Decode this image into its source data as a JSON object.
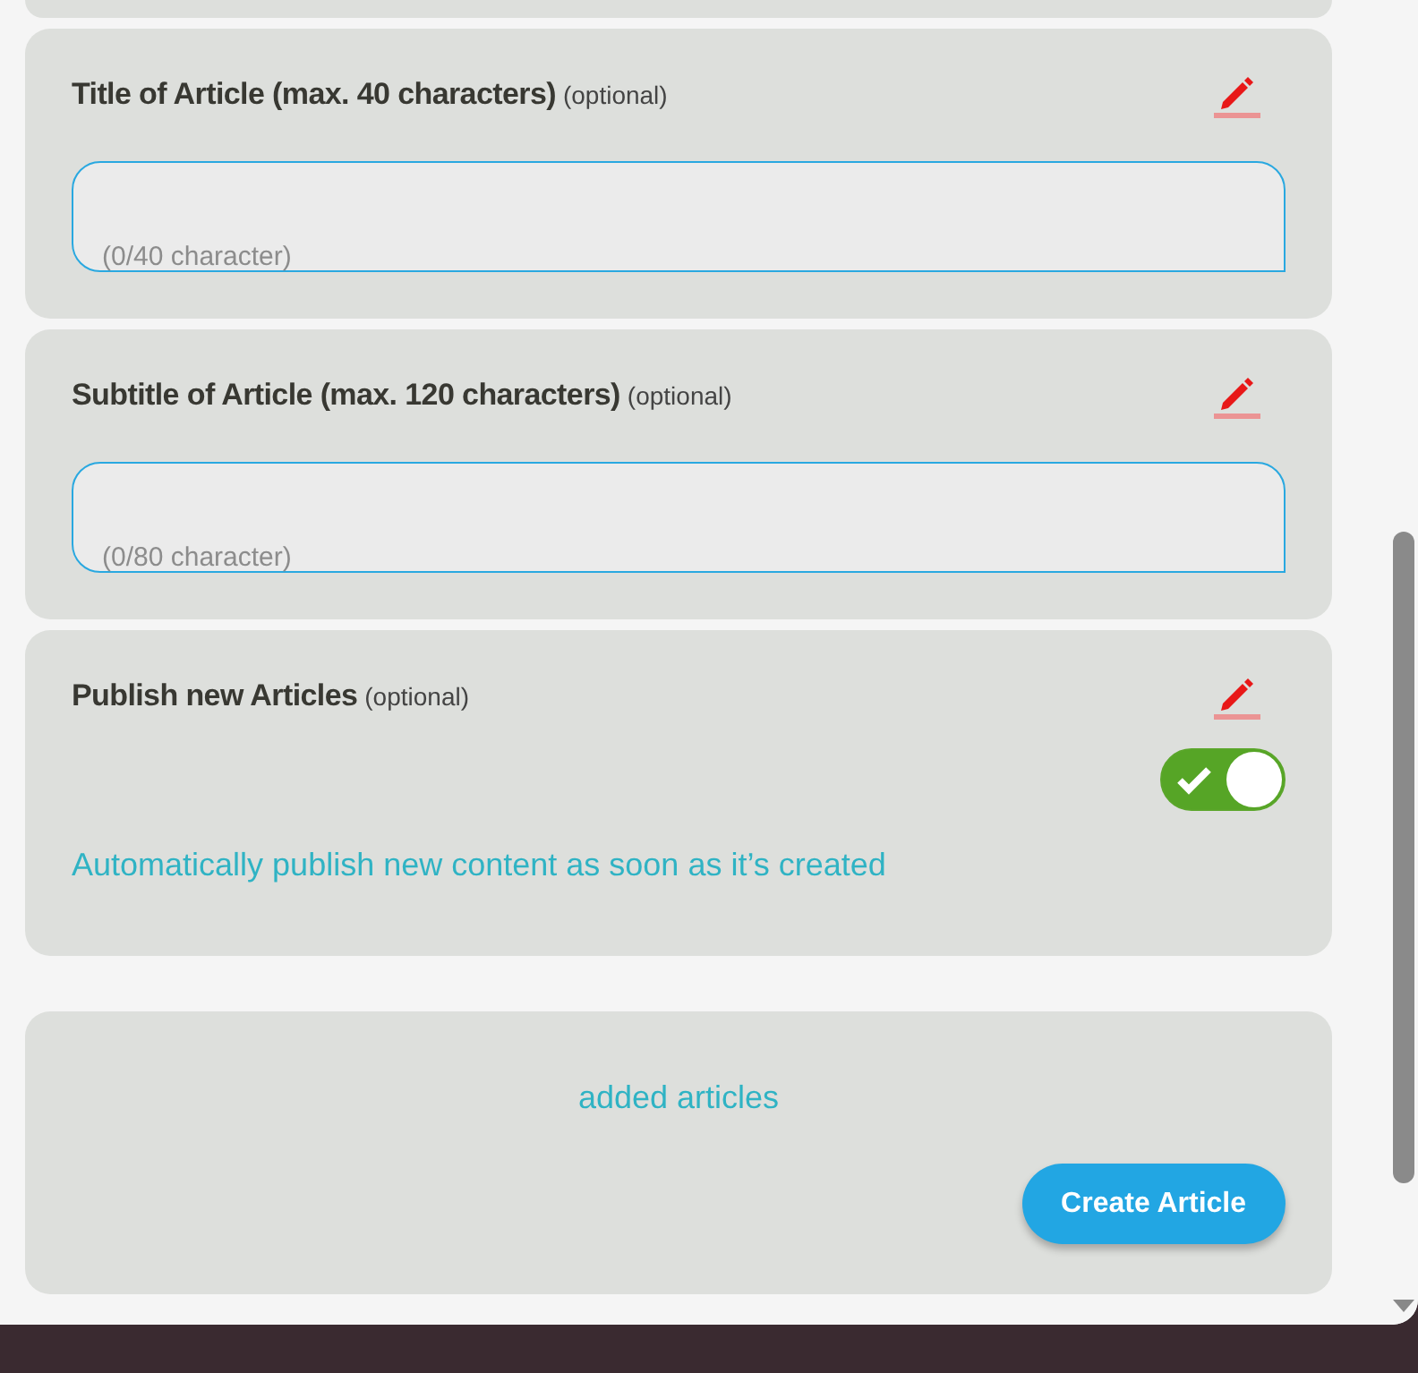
{
  "sections": [
    {
      "kind": "text",
      "title": "Title of Article (max. 40 characters)",
      "note": "(optional)",
      "counter": "(0/40 character)"
    },
    {
      "kind": "text",
      "title": "Subtitle of Article (max. 120 characters)",
      "note": "(optional)",
      "counter": "(0/80 character)"
    },
    {
      "kind": "toggle",
      "title": "Publish new Articles",
      "note": "(optional)",
      "on": true,
      "description": "Automatically publish new content as soon as it’s created"
    }
  ],
  "footer": {
    "label": "added articles",
    "button": "Create Article"
  }
}
